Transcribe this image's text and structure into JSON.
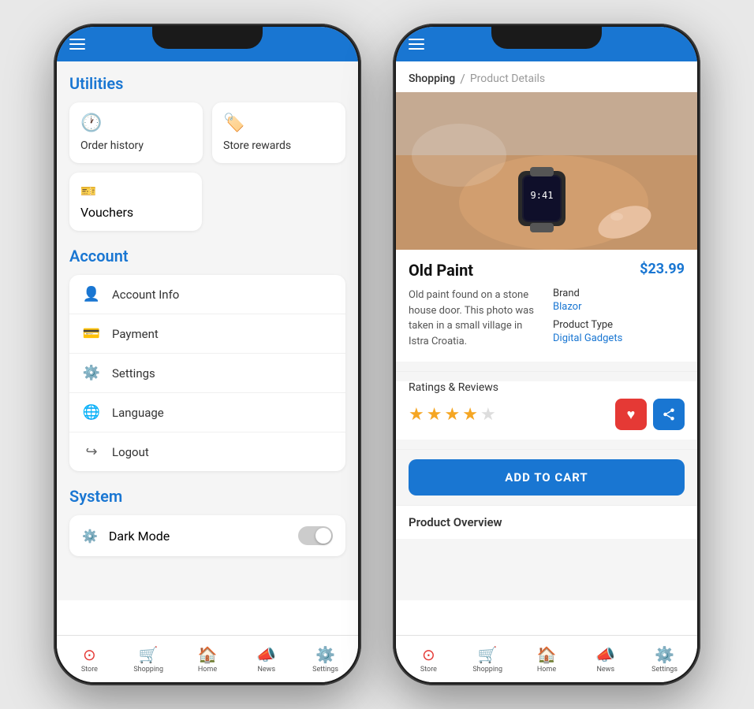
{
  "left_phone": {
    "nav": {
      "hamburger_label": "menu"
    },
    "sections": {
      "utilities": {
        "title": "Utilities",
        "cards": [
          {
            "id": "order-history",
            "icon": "🕐",
            "icon_color": "green",
            "label": "Order history"
          },
          {
            "id": "store-rewards",
            "icon": "🏷️",
            "icon_color": "orange",
            "label": "Store rewards"
          }
        ],
        "extra_card": {
          "id": "vouchers",
          "icon": "🎫",
          "icon_color": "red",
          "label": "Vouchers"
        }
      },
      "account": {
        "title": "Account",
        "items": [
          {
            "id": "account-info",
            "icon": "👤",
            "label": "Account Info"
          },
          {
            "id": "payment",
            "icon": "💳",
            "label": "Payment"
          },
          {
            "id": "settings",
            "icon": "⚙️",
            "label": "Settings"
          },
          {
            "id": "language",
            "icon": "🌐",
            "label": "Language"
          },
          {
            "id": "logout",
            "icon": "🚪",
            "label": "Logout"
          }
        ]
      },
      "system": {
        "title": "System",
        "items": [
          {
            "id": "dark-mode",
            "icon": "⚙️",
            "label": "Dark Mode",
            "has_toggle": true
          }
        ]
      }
    },
    "bottom_nav": [
      {
        "id": "store",
        "icon": "⊙",
        "label": "Store"
      },
      {
        "id": "shopping",
        "icon": "🛒",
        "label": "Shopping"
      },
      {
        "id": "home",
        "icon": "🏠",
        "label": "Home"
      },
      {
        "id": "news",
        "icon": "📣",
        "label": "News"
      },
      {
        "id": "settings",
        "icon": "⚙️",
        "label": "Settings"
      }
    ]
  },
  "right_phone": {
    "nav": {
      "hamburger_label": "menu"
    },
    "breadcrumb": {
      "active": "Shopping",
      "separator": "/",
      "inactive": "Product Details"
    },
    "product": {
      "name": "Old Paint",
      "price": "$23.99",
      "description": "Old paint found on a stone house door. This photo was taken in a small village in Istra Croatia.",
      "brand_label": "Brand",
      "brand_value": "Blazor",
      "type_label": "Product Type",
      "type_value": "Digital Gadgets"
    },
    "ratings": {
      "label": "Ratings & Reviews",
      "stars_filled": 4,
      "stars_empty": 1
    },
    "add_to_cart_label": "ADD TO CART",
    "product_overview_label": "Product Overview",
    "bottom_nav": [
      {
        "id": "store",
        "icon": "⊙",
        "label": "Store"
      },
      {
        "id": "shopping",
        "icon": "🛒",
        "label": "Shopping"
      },
      {
        "id": "home",
        "icon": "🏠",
        "label": "Home"
      },
      {
        "id": "news",
        "icon": "📣",
        "label": "News"
      },
      {
        "id": "settings",
        "icon": "⚙️",
        "label": "Settings"
      }
    ]
  },
  "colors": {
    "primary": "#1976d2",
    "accent_red": "#e53935",
    "accent_green": "#43a047",
    "accent_orange": "#fb8c00"
  }
}
